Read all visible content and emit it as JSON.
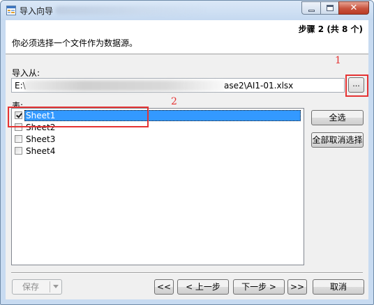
{
  "window": {
    "title": "导入向导",
    "controls": {
      "minimize": "minimize",
      "maximize": "maximize",
      "close": "✕"
    }
  },
  "header": {
    "step": "步骤 2 (共 8 个)",
    "instruction": "你必须选择一个文件作为数据源。"
  },
  "source": {
    "label": "导入从:",
    "path_visible_start": "E:\\",
    "path_visible_end": "ase2\\AI1-01.xlsx",
    "browse_label": "..."
  },
  "tables": {
    "label": "表:",
    "sheets": [
      {
        "name": "Sheet1",
        "checked": true,
        "selected": true
      },
      {
        "name": "Sheet2",
        "checked": false,
        "selected": false
      },
      {
        "name": "Sheet3",
        "checked": false,
        "selected": false
      },
      {
        "name": "Sheet4",
        "checked": false,
        "selected": false
      }
    ],
    "select_all_label": "全选",
    "deselect_all_label": "全部取消选择"
  },
  "footer": {
    "save_label": "保存",
    "first_label": "<<",
    "prev_label": "< 上一步",
    "next_label": "下一步 >",
    "last_label": ">>",
    "cancel_label": "取消"
  },
  "annotations": {
    "browse_marker": "1",
    "sheet_marker": "2",
    "color": "#e53333"
  }
}
